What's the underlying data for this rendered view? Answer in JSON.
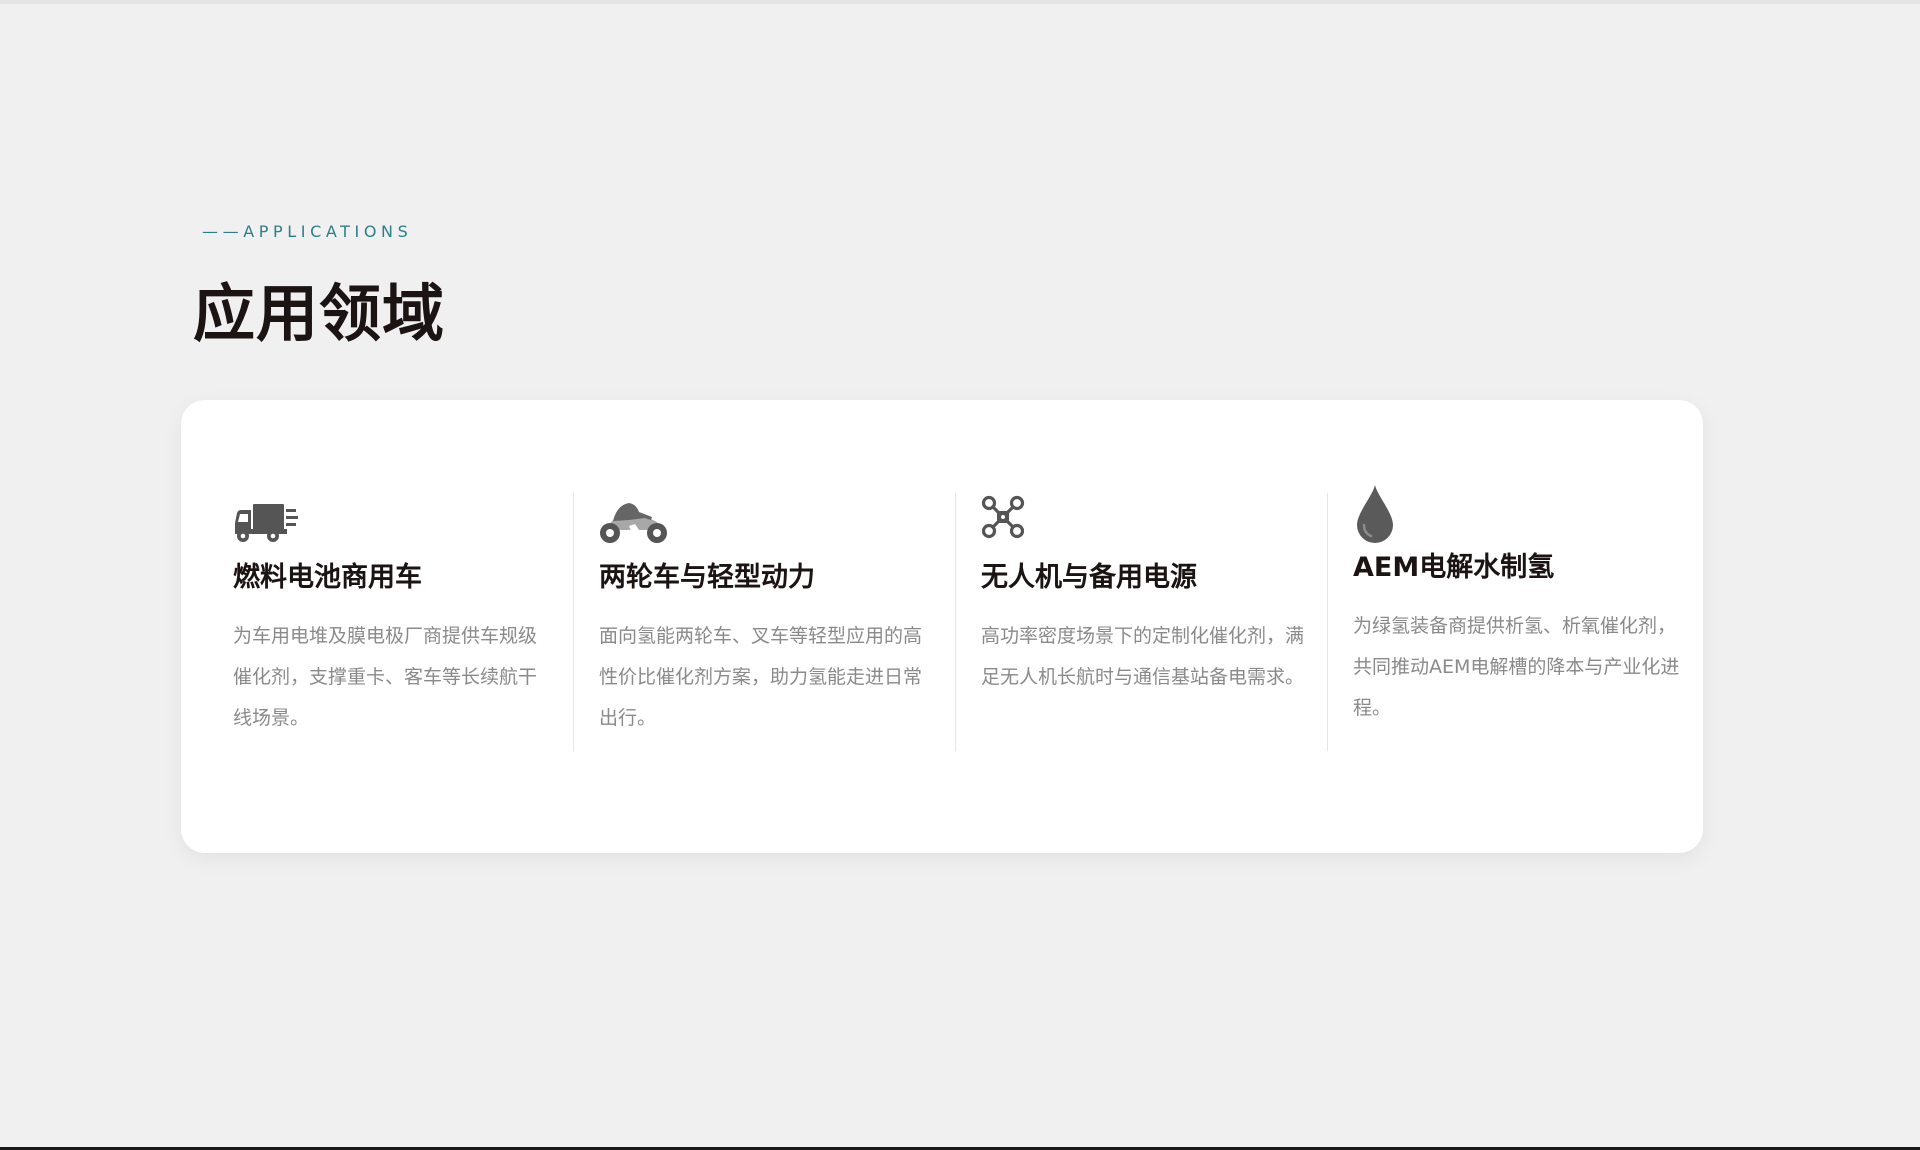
{
  "section": {
    "eyebrow": "——APPLICATIONS",
    "title": "应用领域"
  },
  "applications": [
    {
      "icon": "truck-icon",
      "title": "燃料电池商用车",
      "description": "为车用电堆及膜电极厂商提供车规级催化剂，支撑重卡、客车等长续航干线场景。"
    },
    {
      "icon": "motorcycle-icon",
      "title": "两轮车与轻型动力",
      "description": "面向氢能两轮车、叉车等轻型应用的高性价比催化剂方案，助力氢能走进日常出行。"
    },
    {
      "icon": "drone-icon",
      "title": "无人机与备用电源",
      "description": "高功率密度场景下的定制化催化剂，满足无人机长航时与通信基站备电需求。"
    },
    {
      "icon": "water-drop-icon",
      "title": "AEM电解水制氢",
      "description": "为绿氢装备商提供析氢、析氧催化剂，共同推动AEM电解槽的降本与产业化进程。"
    }
  ],
  "colors": {
    "accent": "#2a8088",
    "heading": "#1c1412",
    "body_text": "#8a8a8a",
    "icon": "#555555",
    "background": "#f0f0f0",
    "card": "#ffffff"
  }
}
